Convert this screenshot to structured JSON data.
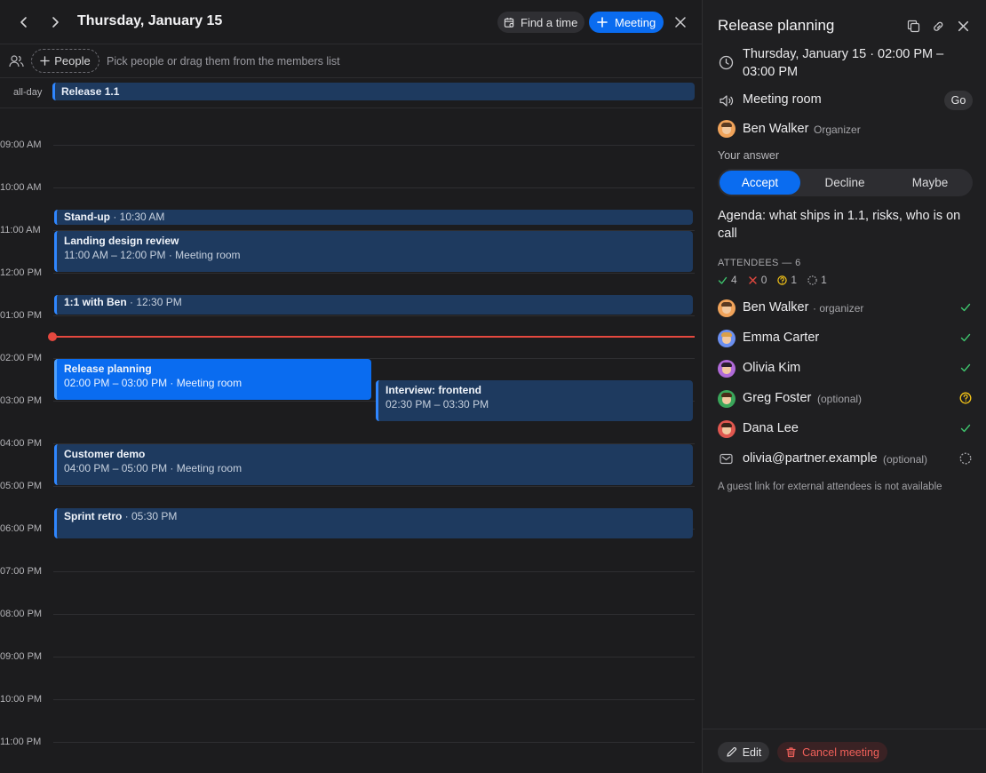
{
  "header": {
    "date_title": "Thursday, January 15",
    "find_time_label": "Find a time",
    "meeting_label": "Meeting"
  },
  "people_bar": {
    "people_label": "People",
    "hint": "Pick people or drag them from the members list"
  },
  "all_day": {
    "label": "all-day",
    "event": "Release 1.1"
  },
  "hours": [
    "09:00 AM",
    "10:00 AM",
    "11:00 AM",
    "12:00 PM",
    "01:00 PM",
    "02:00 PM",
    "03:00 PM",
    "04:00 PM",
    "05:00 PM",
    "06:00 PM",
    "07:00 PM",
    "08:00 PM",
    "09:00 PM",
    "10:00 PM",
    "11:00 PM"
  ],
  "events": {
    "standup": {
      "title": "Stand-up",
      "time": " · 10:30 AM"
    },
    "landing": {
      "title": "Landing design review",
      "sub": "11:00 AM – 12:00 PM · Meeting room"
    },
    "one_on_one": {
      "title": "1:1 with Ben",
      "time": " · 12:30 PM"
    },
    "release": {
      "title": "Release planning",
      "sub": "02:00 PM – 03:00 PM · Meeting room"
    },
    "interview": {
      "title": "Interview: frontend",
      "sub": "02:30 PM – 03:30 PM"
    },
    "demo": {
      "title": "Customer demo",
      "sub": "04:00 PM – 05:00 PM · Meeting room"
    },
    "retro": {
      "title": "Sprint retro",
      "time": " · 05:30 PM"
    }
  },
  "detail": {
    "title": "Release planning",
    "datetime": "Thursday, January 15 · 02:00 PM – 03:00 PM",
    "room": "Meeting room",
    "go_label": "Go",
    "organizer_name": "Ben Walker",
    "organizer_role": "Organizer",
    "your_answer_label": "Your answer",
    "answers": [
      "Accept",
      "Decline",
      "Maybe"
    ],
    "selected_answer": "Accept",
    "agenda": "Agenda: what ships in 1.1, risks, who is on call",
    "attendees_header": "ATTENDEES — 6",
    "summary": {
      "accepted": "4",
      "declined": "0",
      "maybe": "1",
      "pending": "1"
    },
    "attendees": [
      {
        "name": "Ben Walker",
        "tag": "· organizer",
        "status": "accepted"
      },
      {
        "name": "Emma Carter",
        "tag": "",
        "status": "accepted"
      },
      {
        "name": "Olivia Kim",
        "tag": "",
        "status": "accepted"
      },
      {
        "name": "Greg Foster",
        "tag": "(optional)",
        "status": "maybe"
      },
      {
        "name": "Dana Lee",
        "tag": "",
        "status": "accepted"
      },
      {
        "name": "olivia@partner.example",
        "tag": "(optional)",
        "status": "pending"
      }
    ],
    "guest_note": "A guest link for external attendees is not available",
    "edit_label": "Edit",
    "cancel_label": "Cancel meeting"
  },
  "colors": {
    "accent": "#0a6cf0",
    "event_bg": "#1e3a5f",
    "now_line": "#e5483f",
    "accepted": "#3ec46d",
    "declined": "#e5483f",
    "maybe": "#f5c518"
  }
}
